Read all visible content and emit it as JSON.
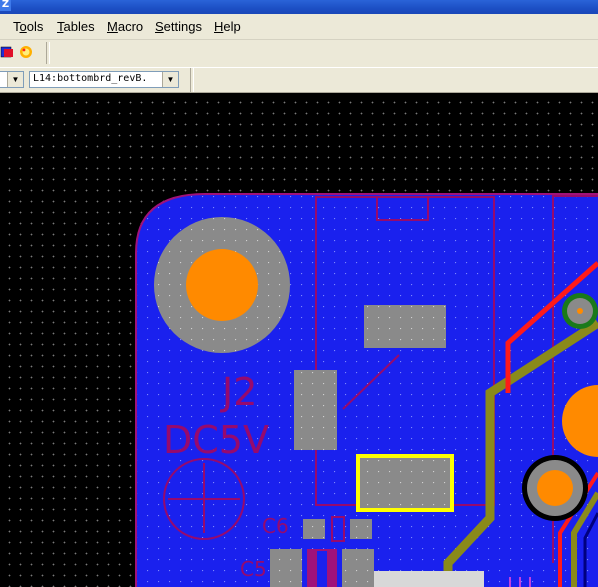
{
  "window": {
    "title_glyph": "Z"
  },
  "menu": {
    "items": [
      {
        "pre": "T",
        "ul": "o",
        "post": "ols"
      },
      {
        "pre": "",
        "ul": "T",
        "post": "ables"
      },
      {
        "pre": "",
        "ul": "M",
        "post": "acro"
      },
      {
        "pre": "",
        "ul": "S",
        "post": "ettings"
      },
      {
        "pre": "",
        "ul": "H",
        "post": "elp"
      }
    ]
  },
  "toolbar": {
    "layer_combo_value": "L14:bottombrd_revB."
  },
  "board": {
    "labels": {
      "connector_ref": "J2",
      "connector_value": "DC5V",
      "cap_c6": "C6",
      "cap_c5": "C5"
    },
    "colors": {
      "board_fill": "#1a21ee",
      "outline": "#960a6e",
      "pad": "#8a8a8a",
      "drill": "#ff8a00",
      "trace_red": "#ff1a1a",
      "trace_olive": "#8a8a1a",
      "selection": "#ffff00"
    }
  }
}
